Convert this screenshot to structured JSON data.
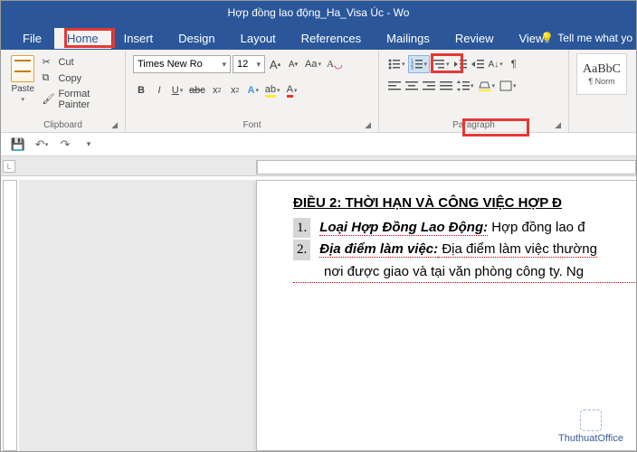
{
  "title": "Hợp đồng lao động_Ha_Visa Úc - Wo",
  "menu": {
    "file": "File",
    "home": "Home",
    "insert": "Insert",
    "design": "Design",
    "layout": "Layout",
    "references": "References",
    "mailings": "Mailings",
    "review": "Review",
    "view": "View",
    "tellme": "Tell me what yo"
  },
  "clipboard": {
    "paste": "Paste",
    "cut": "Cut",
    "copy": "Copy",
    "format_painter": "Format Painter",
    "label": "Clipboard"
  },
  "font": {
    "name": "Times New Ro",
    "size": "12",
    "label": "Font"
  },
  "paragraph": {
    "label": "Paragraph"
  },
  "styles": {
    "preview": "AaBbC",
    "name": "¶ Norm"
  },
  "ruler_corner": "L",
  "doc": {
    "heading": "ĐIỀU 2: THỜI HẠN VÀ CÔNG VIỆC HỢP Đ",
    "items": [
      {
        "num": "1.",
        "lead": "Loại Hợp Đồng Lao Động:",
        "rest": " Hợp đồng lao đ"
      },
      {
        "num": "2.",
        "lead": "Địa điểm làm việc:",
        "rest": " Địa điểm làm việc thường"
      }
    ],
    "cont": "nơi được giao và tại văn phòng công ty. Ng"
  },
  "watermark": "ThuthuatOffice"
}
